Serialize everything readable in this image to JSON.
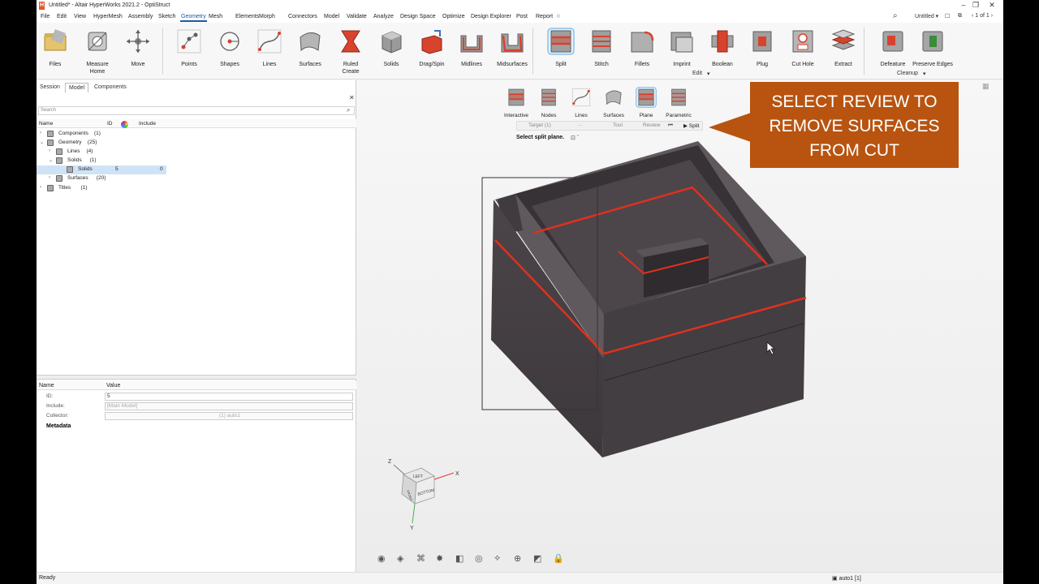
{
  "window": {
    "app_logo": "H",
    "title": "Untitled* - Altair HyperWorks 2021.2 - OptiStruct"
  },
  "menu": {
    "items": [
      "File",
      "Edit",
      "View",
      "HyperMesh",
      "Assembly",
      "Sketch",
      "Geometry",
      "Mesh",
      "Elements",
      "Morph",
      "Connectors",
      "Model",
      "Validate",
      "Analyze",
      "Design Space",
      "Optimize",
      "Design Explorer",
      "Post",
      "Report"
    ],
    "active": "Geometry",
    "session_name": "Untitled",
    "page_indicator": "1 of 1"
  },
  "ribbon": {
    "tools": [
      {
        "label": "Files",
        "icon": "folder-icon"
      },
      {
        "label": "Measure\nHome",
        "icon": "measure-icon"
      },
      {
        "label": "Move",
        "icon": "move-icon"
      },
      {
        "label": "Points",
        "icon": "points-icon"
      },
      {
        "label": "Shapes",
        "icon": "shapes-icon"
      },
      {
        "label": "Lines",
        "icon": "lines-icon"
      },
      {
        "label": "Surfaces",
        "icon": "surfaces-icon"
      },
      {
        "label": "Ruled\nCreate",
        "icon": "ruled-icon"
      },
      {
        "label": "Solids",
        "icon": "solids-icon"
      },
      {
        "label": "Drag/Spin",
        "icon": "drag-spin-icon"
      },
      {
        "label": "Midlines",
        "icon": "midlines-icon"
      },
      {
        "label": "Midsurfaces",
        "icon": "midsurfaces-icon"
      },
      {
        "label": "Split",
        "icon": "split-icon"
      },
      {
        "label": "Stitch",
        "icon": "stitch-icon"
      },
      {
        "label": "Fillets",
        "icon": "fillets-icon"
      },
      {
        "label": "Imprint",
        "icon": "imprint-icon"
      },
      {
        "label": "Boolean",
        "icon": "boolean-icon"
      },
      {
        "label": "Plug",
        "icon": "plug-icon"
      },
      {
        "label": "Cut Hole",
        "icon": "cut-hole-icon"
      },
      {
        "label": "Extract",
        "icon": "extract-icon"
      },
      {
        "label": "Defeature",
        "icon": "defeature-icon"
      },
      {
        "label": "Preserve Edges",
        "icon": "preserve-edges-icon"
      }
    ],
    "group_edit": "Edit",
    "group_cleanup": "Cleanup"
  },
  "panel": {
    "tabs": [
      "Session",
      "Model",
      "Components"
    ],
    "active_tab": "Model",
    "search_placeholder": "Search",
    "columns": [
      "Name",
      "ID",
      "Include"
    ],
    "tree": [
      {
        "label": "Components",
        "count": "(1)"
      },
      {
        "label": "Geometry",
        "count": "(25)"
      },
      {
        "label": "Lines",
        "count": "(4)"
      },
      {
        "label": "Solids",
        "count": "(1)"
      },
      {
        "label": "Solids",
        "id": "5",
        "include": "0"
      },
      {
        "label": "Surfaces",
        "count": "(20)"
      },
      {
        "label": "Titles",
        "count": "(1)"
      }
    ]
  },
  "properties": {
    "col_name": "Name",
    "col_value": "Value",
    "rows": [
      {
        "name": "ID:",
        "value": "5"
      },
      {
        "name": "Include:",
        "value": "[Main Model]"
      },
      {
        "name": "Collector:",
        "value": "(1) auto1"
      }
    ],
    "metadata": "Metadata"
  },
  "split_tools": [
    "Interactive",
    "Nodes",
    "Lines",
    "Surfaces",
    "Plane",
    "Parametric"
  ],
  "context": {
    "target": "Target (1)",
    "more": "···",
    "tool": "Tool",
    "review": "Review",
    "split": "▶ Split",
    "hint": "Select split plane."
  },
  "callout": {
    "lines": [
      "SELECT REVIEW TO",
      "REMOVE SURFACES",
      "FROM CUT"
    ]
  },
  "viewcube": {
    "faces": [
      "LEFT",
      "FRONT",
      "BOTTOM"
    ],
    "axes": [
      "Z",
      "X",
      "Y"
    ]
  },
  "status": {
    "left": "Ready",
    "component": "auto1 [1]"
  },
  "colors": {
    "callout": "#b85410",
    "accent": "#1b58a8",
    "split_line": "#e0301e",
    "solid": "#4a4448"
  }
}
